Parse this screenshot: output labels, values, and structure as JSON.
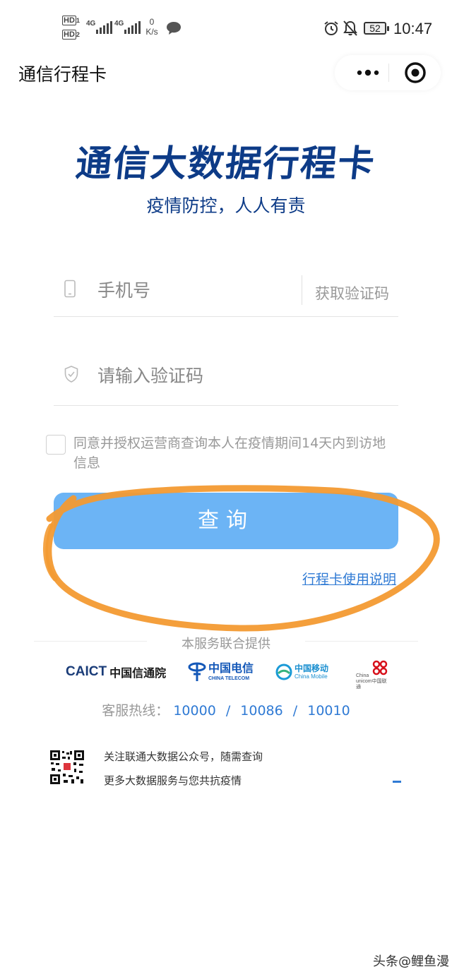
{
  "status_bar": {
    "hd1": "HD",
    "hd1_sub": "1",
    "hd2": "HD",
    "hd2_sub": "2",
    "net1": "4G",
    "net2": "4G",
    "speed_value": "0",
    "speed_unit": "K/s",
    "battery": "52",
    "time": "10:47"
  },
  "header": {
    "title": "通信行程卡"
  },
  "hero": {
    "title": "通信大数据行程卡",
    "subtitle": "疫情防控，人人有责"
  },
  "form": {
    "phone_placeholder": "手机号",
    "get_code_label": "获取验证码",
    "code_placeholder": "请输入验证码",
    "agreement_text": "同意并授权运营商查询本人在疫情期间14天内到访地信息",
    "query_button": "查询",
    "guide_link": "行程卡使用说明"
  },
  "footer": {
    "provided_by": "本服务联合提供",
    "logos": {
      "caict_en": "CAICT",
      "caict_cn": "中国信通院",
      "telecom_cn": "中国电信",
      "telecom_en": "CHINA TELECOM",
      "mobile_cn": "中国移动",
      "mobile_en": "China Mobile",
      "unicom_en1": "China",
      "unicom_en2": "unicom中国联通"
    },
    "hotline_label": "客服热线：",
    "hotline_numbers": [
      "10000",
      "10086",
      "10010"
    ],
    "hotline_sep": "/",
    "qr_line1": "关注联通大数据公众号，随需查询",
    "qr_line2": "更多大数据服务与您共抗疫情"
  },
  "watermark": "头条@鲤鱼漫",
  "colors": {
    "brand_blue": "#0d3b87",
    "button_blue": "#6cb4f5",
    "link_blue": "#2f7ad4",
    "marker_orange": "#f39a32"
  }
}
